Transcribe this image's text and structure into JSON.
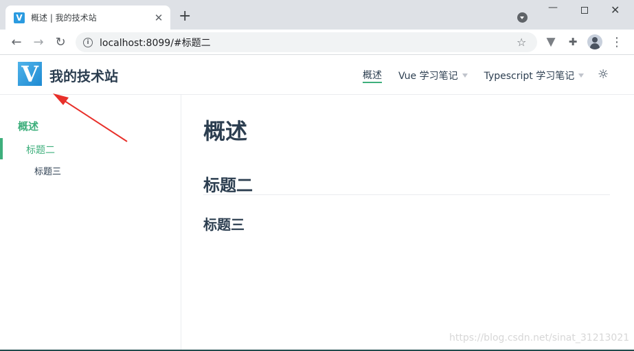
{
  "browser": {
    "tab": {
      "favicon_letter": "V",
      "title": "概述 | 我的技术站",
      "close_glyph": "✕"
    },
    "new_tab_glyph": "+",
    "window_controls": {
      "minimize": "—",
      "close": "✕"
    },
    "toolbar": {
      "back": "←",
      "forward": "→",
      "reload": "↻",
      "url": "localhost:8099/#标题二",
      "star": "☆",
      "menu": "⋮"
    }
  },
  "site": {
    "logo_letter": "V",
    "title": "我的技术站",
    "nav": [
      {
        "label": "概述",
        "active": true
      },
      {
        "label": "Vue 学习笔记",
        "dropdown": true
      },
      {
        "label": "Typescript 学习笔记",
        "dropdown": true
      }
    ],
    "theme_icon": "sun-icon"
  },
  "sidebar": {
    "heading": "概述",
    "items": [
      {
        "label": "标题二",
        "active": true
      },
      {
        "label": "标题三"
      }
    ]
  },
  "content": {
    "h1": "概述",
    "h2": "标题二",
    "h3": "标题三"
  },
  "watermark": "https://blog.csdn.net/sinat_31213021",
  "colors": {
    "accent": "#3eaf7c",
    "text": "#2c3e50",
    "annotation_arrow": "#e8302a"
  }
}
